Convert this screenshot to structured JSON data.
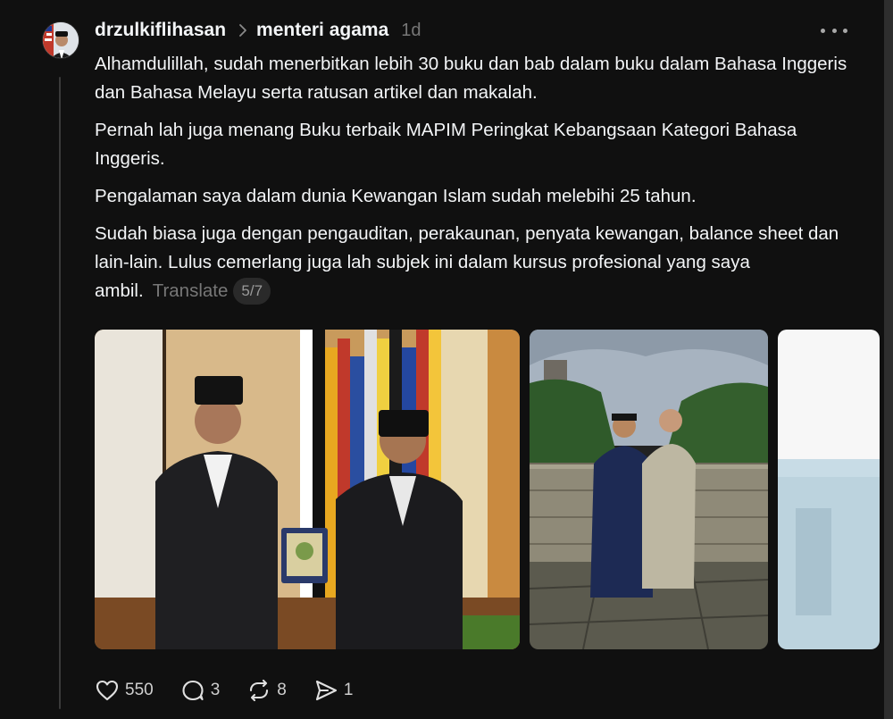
{
  "post": {
    "username": "drzulkiflihasan",
    "topic": "menteri agama",
    "time": "1d",
    "paragraphs": [
      "Alhamdulillah, sudah menerbitkan lebih 30 buku dan bab dalam buku dalam Bahasa Inggeris dan Bahasa Melayu serta ratusan artikel dan makalah.",
      "Pernah lah juga menang Buku terbaik MAPIM Peringkat Kebangsaan Kategori Bahasa Inggeris.",
      "Pengalaman saya dalam dunia Kewangan Islam sudah melebihi 25 tahun."
    ],
    "last_paragraph": "Sudah biasa juga dengan pengauditan, perakaunan, penyata kewangan, balance sheet dan lain-lain. Lulus cemerlang juga lah subjek ini dalam kursus profesional yang saya ambil.",
    "translate_label": "Translate",
    "thread_count": "5/7"
  },
  "actions": {
    "likes": "550",
    "replies": "3",
    "reposts": "8",
    "shares": "1"
  },
  "icons": {
    "avatar": "avatar",
    "chevron": "chevron-right-icon",
    "more": "more-dots-icon",
    "like": "heart-icon",
    "reply": "comment-icon",
    "repost": "repost-icon",
    "share": "send-icon"
  },
  "colors": {
    "background": "#101010",
    "text": "#f3f5f7",
    "muted": "#777777"
  }
}
